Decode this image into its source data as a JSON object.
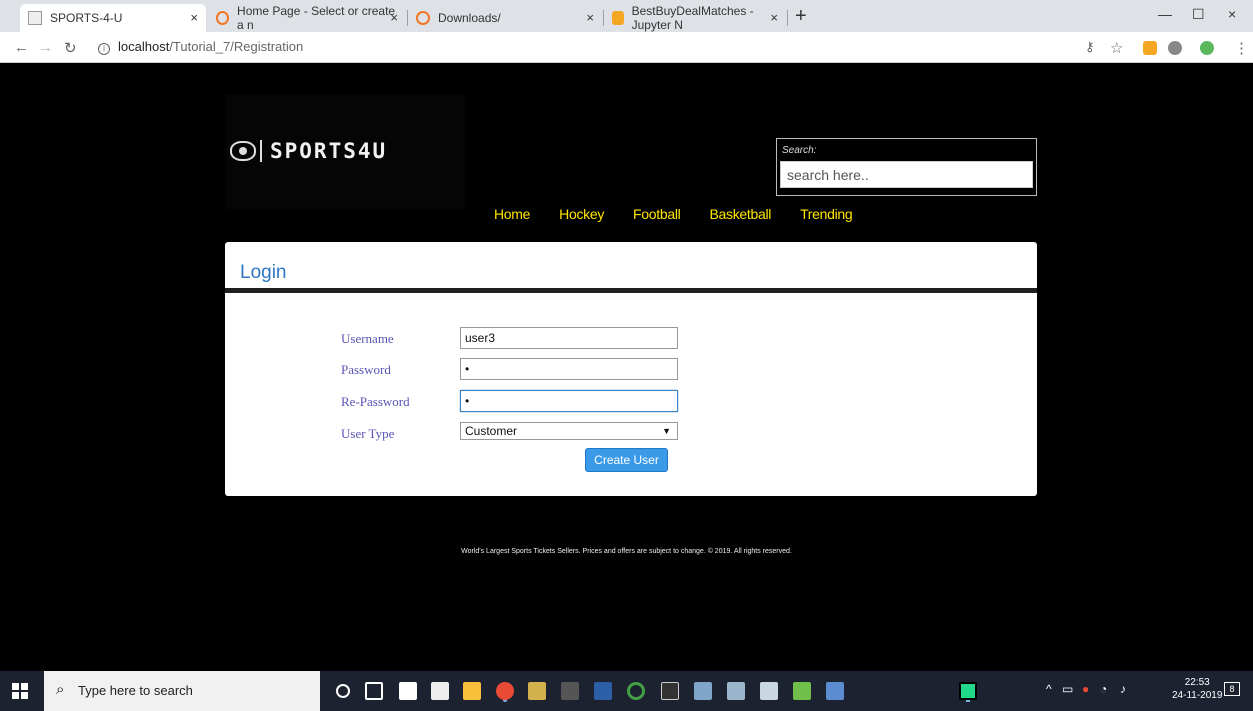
{
  "browser": {
    "tabs": [
      {
        "title": "SPORTS-4-U",
        "close": "×"
      },
      {
        "title": "Home Page - Select or create a n",
        "close": "×"
      },
      {
        "title": "Downloads/",
        "close": "×"
      },
      {
        "title": "BestBuyDealMatches - Jupyter N",
        "close": "×"
      }
    ],
    "new_tab": "+",
    "url_host": "localhost",
    "url_path": "/Tutorial_7/Registration",
    "window": {
      "minimize": "—",
      "maximize": "☐",
      "close": "×"
    }
  },
  "site": {
    "brand": "SPORTS4U",
    "search_label": "Search:",
    "search_placeholder": "search here..",
    "nav": [
      "Home",
      "Hockey",
      "Football",
      "Basketball",
      "Trending"
    ]
  },
  "login": {
    "title": "Login",
    "fields": {
      "username": {
        "label": "Username",
        "value": "user3"
      },
      "password": {
        "label": "Password",
        "value": "•"
      },
      "repassword": {
        "label": "Re-Password",
        "value": "•"
      },
      "usertype": {
        "label": "User Type",
        "value": "Customer"
      }
    },
    "submit": "Create User"
  },
  "footer": {
    "text": "World's Largest Sports Tickets Sellers. Prices and offers are subject to change. © 2019. All rights reserved."
  },
  "taskbar": {
    "search_placeholder": "Type here to search",
    "time": "22:53",
    "date": "24-11-2019",
    "notification_count": "8"
  }
}
